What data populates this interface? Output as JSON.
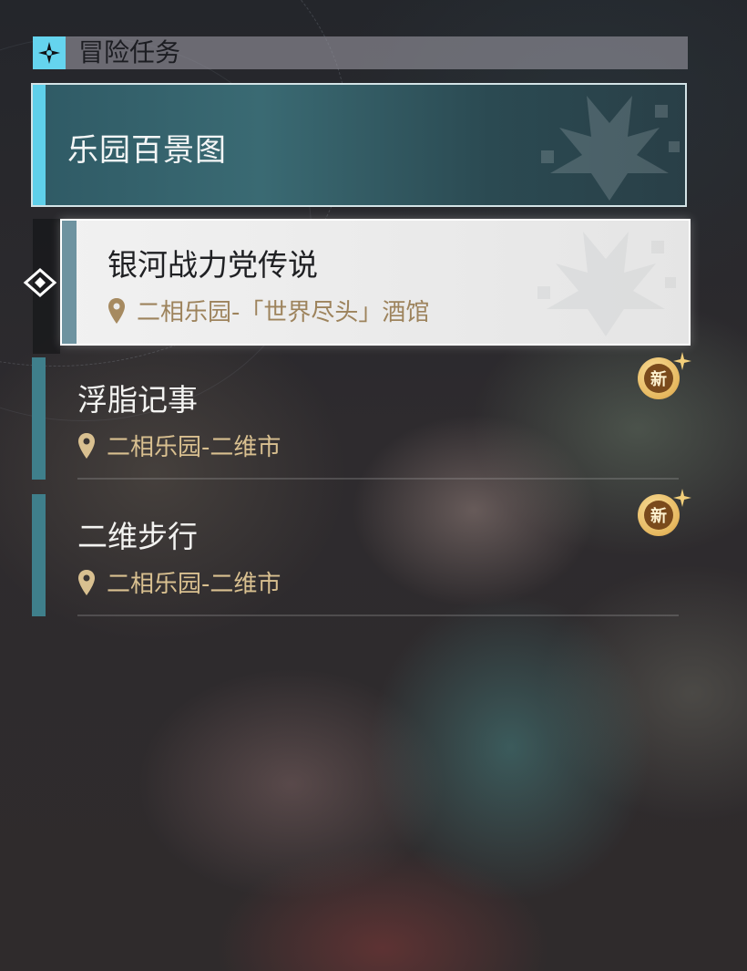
{
  "header": {
    "title": "冒险任务",
    "icon": "sparkle-icon"
  },
  "quests": [
    {
      "title": "乐园百景图",
      "state": "category"
    },
    {
      "title": "银河战力党传说",
      "location": "二相乐园-「世界尽头」酒馆",
      "state": "selected"
    },
    {
      "title": "浮脂记事",
      "location": "二相乐园-二维市",
      "badge": "新"
    },
    {
      "title": "二维步行",
      "location": "二相乐园-二维市",
      "badge": "新"
    }
  ],
  "colors": {
    "accent": "#65d4ee",
    "location": "#d9c090",
    "badge": "#e6b75e"
  }
}
